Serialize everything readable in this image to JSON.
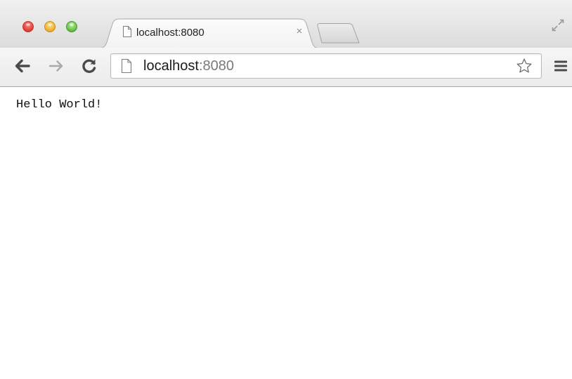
{
  "browser": {
    "tab": {
      "title": "localhost:8080",
      "close_label": "×"
    },
    "address_bar": {
      "host": "localhost",
      "port": ":8080"
    },
    "icons": {
      "close": "close-window-icon",
      "minimize": "minimize-window-icon",
      "maximize": "maximize-window-icon",
      "tab_page": "page-icon",
      "new_tab": "new-tab-icon",
      "fullscreen": "fullscreen-icon",
      "back": "back-arrow-icon",
      "forward": "forward-arrow-icon",
      "reload": "reload-icon",
      "url_page": "page-icon",
      "bookmark": "star-icon",
      "menu": "hamburger-menu-icon"
    },
    "colors": {
      "close": "#e0443e",
      "minimize": "#f2b33d",
      "maximize": "#6fc24c"
    }
  },
  "page": {
    "body_text": "Hello World!"
  }
}
